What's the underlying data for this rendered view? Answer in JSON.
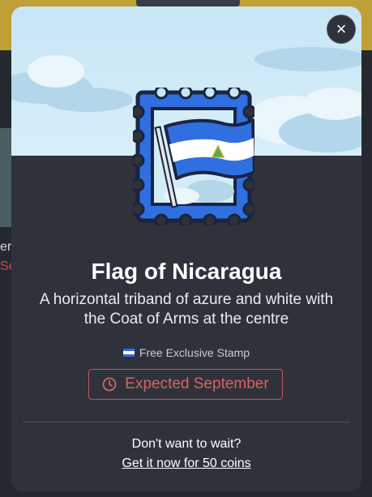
{
  "background": {
    "peek_text_1": "er",
    "peek_text_2": "Se"
  },
  "modal": {
    "close_label": "×",
    "title": "Flag of Nicaragua",
    "description": "A horizontal triband of azure and white with the Coat of Arms at the centre",
    "exclusive_label": "Free Exclusive Stamp",
    "expected_label": "Expected September",
    "wait_text": "Don't want to wait?",
    "get_now_link": "Get it now for 50 coins"
  },
  "colors": {
    "flag_blue": "#2f6fe0",
    "stamp_outline": "#1b2440",
    "accent_red": "#d66464",
    "sky": "#c8e6f5"
  },
  "icons": {
    "close": "close-icon",
    "clock": "clock-icon",
    "flag": "nicaragua-flag-icon"
  }
}
